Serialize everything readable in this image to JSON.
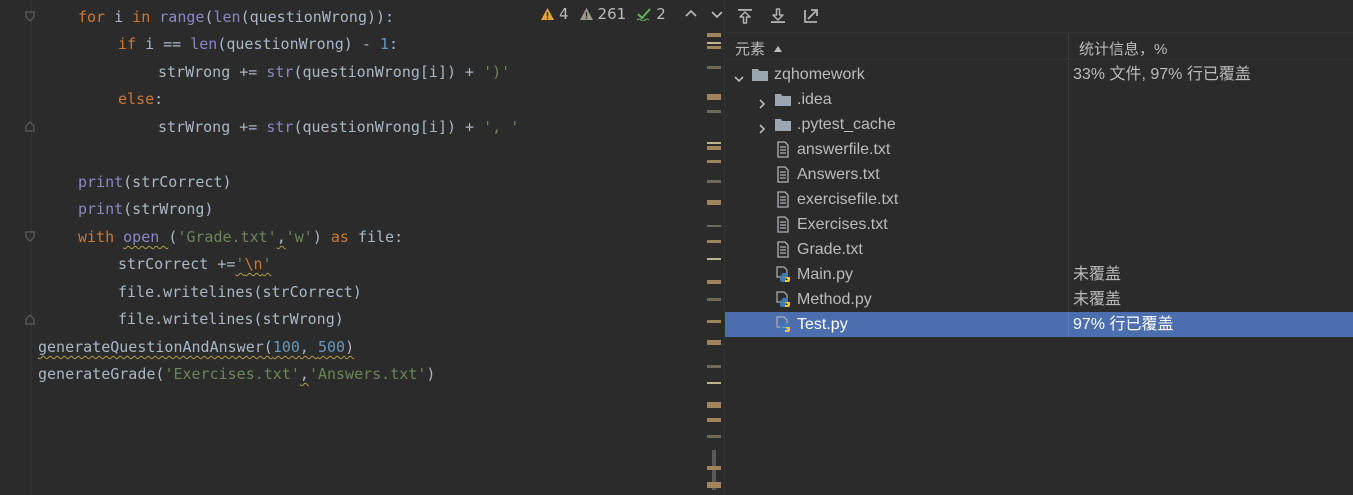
{
  "inspections": {
    "warnings": "4",
    "weak_warnings": "261",
    "typos": "2"
  },
  "code_lines": [
    "for i in range(len(questionWrong)):",
    "if i == len(questionWrong) - 1:",
    "strWrong += str(questionWrong[i]) + ')'",
    "else:",
    "strWrong += str(questionWrong[i]) + ', '",
    "",
    "print(strCorrect)",
    "print(strWrong)",
    "with open ('Grade.txt','w') as file:",
    "strCorrect +='\\n'",
    "file.writelines(strCorrect)",
    "file.writelines(strWrong)",
    "generateQuestionAndAnswer(100, 500)",
    "generateGrade('Exercises.txt','Answers.txt')"
  ],
  "coverage": {
    "toolbar": [
      "import-icon",
      "export-icon",
      "navigate-icon"
    ],
    "col_element": "元素",
    "col_stats": "统计信息，%",
    "rows": [
      {
        "name": "zqhomework",
        "stat": "33% 文件, 97% 行已覆盖",
        "type": "folder",
        "expanded": true,
        "level": 0
      },
      {
        "name": ".idea",
        "stat": "",
        "type": "folder",
        "expanded": false,
        "level": 1
      },
      {
        "name": ".pytest_cache",
        "stat": "",
        "type": "folder",
        "expanded": false,
        "level": 1
      },
      {
        "name": "answerfile.txt",
        "stat": "",
        "type": "text",
        "level": 1
      },
      {
        "name": "Answers.txt",
        "stat": "",
        "type": "text",
        "level": 1
      },
      {
        "name": "exercisefile.txt",
        "stat": "",
        "type": "text",
        "level": 1
      },
      {
        "name": "Exercises.txt",
        "stat": "",
        "type": "text",
        "level": 1
      },
      {
        "name": "Grade.txt",
        "stat": "",
        "type": "text",
        "level": 1
      },
      {
        "name": "Main.py",
        "stat": "未覆盖",
        "type": "python",
        "level": 1
      },
      {
        "name": "Method.py",
        "stat": "未覆盖",
        "type": "python",
        "level": 1
      },
      {
        "name": "Test.py",
        "stat": "97% 行已覆盖",
        "type": "python",
        "level": 1,
        "selected": true
      }
    ]
  },
  "colors": {
    "selection": "#4b6eaf",
    "keyword": "#cc7832",
    "string": "#6a8759",
    "number": "#6897bb",
    "builtin": "#8888c6"
  }
}
